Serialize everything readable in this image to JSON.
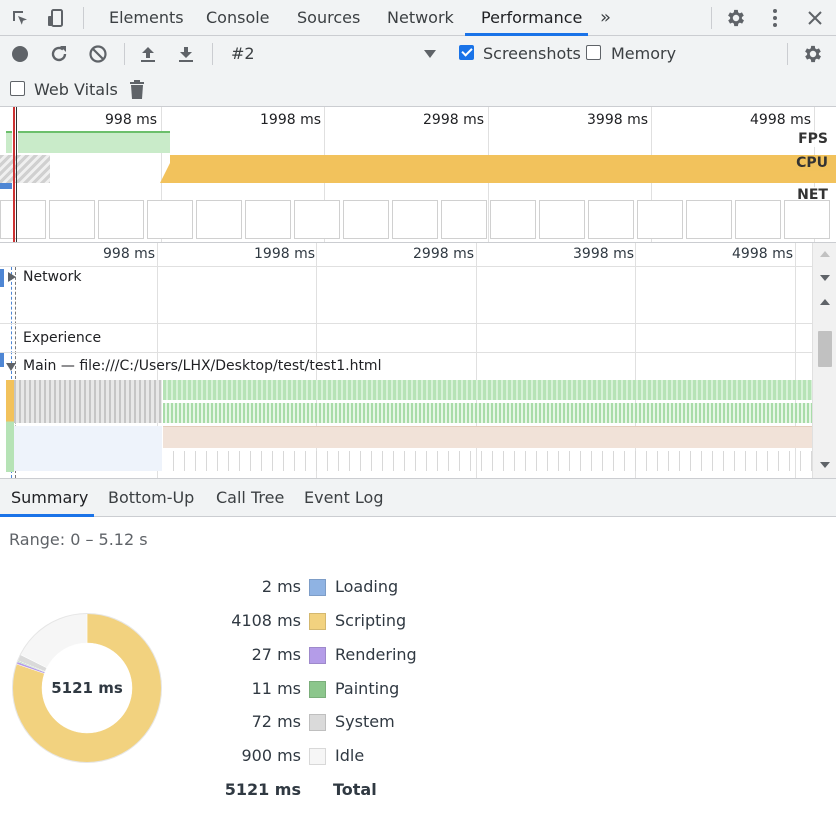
{
  "devtools": {
    "tabs": [
      {
        "label": "Elements"
      },
      {
        "label": "Console"
      },
      {
        "label": "Sources"
      },
      {
        "label": "Network"
      },
      {
        "label": "Performance",
        "active": true
      }
    ],
    "more_tabs": "»"
  },
  "toolbar": {
    "profile_select": "#2",
    "screenshots_label": "Screenshots",
    "screenshots_checked": true,
    "memory_label": "Memory",
    "memory_checked": false,
    "web_vitals_label": "Web Vitals",
    "web_vitals_checked": false
  },
  "overview": {
    "tick_labels": [
      "998 ms",
      "1998 ms",
      "2998 ms",
      "3998 ms",
      "4998 ms"
    ],
    "tracks": [
      "FPS",
      "CPU",
      "NET"
    ]
  },
  "timeline": {
    "tick_labels": [
      "998 ms",
      "1998 ms",
      "2998 ms",
      "3998 ms",
      "4998 ms"
    ],
    "tracks": {
      "network": "Network",
      "experience": "Experience",
      "main": "Main — file:///C:/Users/LHX/Desktop/test/test1.html"
    }
  },
  "bottom_tabs": [
    {
      "label": "Summary",
      "active": true
    },
    {
      "label": "Bottom-Up"
    },
    {
      "label": "Call Tree"
    },
    {
      "label": "Event Log"
    }
  ],
  "summary": {
    "range": "Range: 0 – 5.12 s",
    "total_label_center": "5121 ms",
    "items": [
      {
        "value": "2 ms",
        "name": "Loading",
        "ms": 2,
        "color": "#8fb3e3"
      },
      {
        "value": "4108 ms",
        "name": "Scripting",
        "ms": 4108,
        "color": "#f2d27f"
      },
      {
        "value": "27 ms",
        "name": "Rendering",
        "ms": 27,
        "color": "#b49ce8"
      },
      {
        "value": "11 ms",
        "name": "Painting",
        "ms": 11,
        "color": "#8cc68c"
      },
      {
        "value": "72 ms",
        "name": "System",
        "ms": 72,
        "color": "#dadada"
      },
      {
        "value": "900 ms",
        "name": "Idle",
        "ms": 900,
        "color": "#f6f6f6"
      }
    ],
    "total": {
      "value": "5121 ms",
      "name": "Total"
    }
  }
}
